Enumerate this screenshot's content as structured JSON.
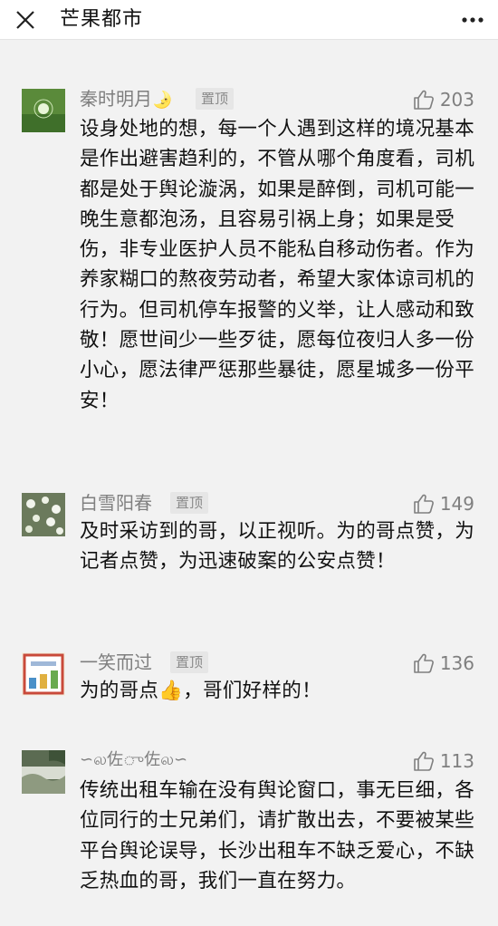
{
  "header": {
    "title": "芒果都市",
    "close_icon": "close-icon",
    "more_icon": "more-icon"
  },
  "colors": {
    "background": "#f2f2f2",
    "header_bg": "#ffffff",
    "name_gray": "#7f7f7f",
    "pin_bg": "#e6e6e6",
    "text": "#111111"
  },
  "comments": [
    {
      "name": "秦时明月",
      "name_emoji": "🌛",
      "pinned_label": "置顶",
      "likes": "203",
      "text": "设身处地的想，每一个人遇到这样的境况基本是作出避害趋利的，不管从哪个角度看，司机都是处于舆论漩涡，如果是醉倒，司机可能一晚生意都泡汤，且容易引祸上身；如果是受伤，非专业医护人员不能私自移动伤者。作为养家糊口的熬夜劳动者，希望大家体谅司机的行为。但司机停车报警的义举，让人感动和致敬！愿世间少一些歹徒，愿每位夜归人多一份小心，愿法律严惩那些暴徒，愿星城多一份平安！"
    },
    {
      "name": "白雪阳春",
      "pinned_label": "置顶",
      "likes": "149",
      "text": "及时采访到的哥，以正视听。为的哥点赞，为记者点赞，为迅速破案的公安点赞！"
    },
    {
      "name": "一笑而过",
      "pinned_label": "置顶",
      "likes": "136",
      "text_before": "为的哥点",
      "emoji": "👍",
      "text_after": "，哥们好样的！"
    },
    {
      "name": "∽ல佐ு佐ல∽",
      "likes": "113",
      "text": "传统出租车输在没有舆论窗口，事无巨细，各位同行的士兄弟们，请扩散出去，不要被某些平台舆论误导，长沙出租车不缺乏爱心，不缺乏热血的哥，我们一直在努力。"
    }
  ]
}
